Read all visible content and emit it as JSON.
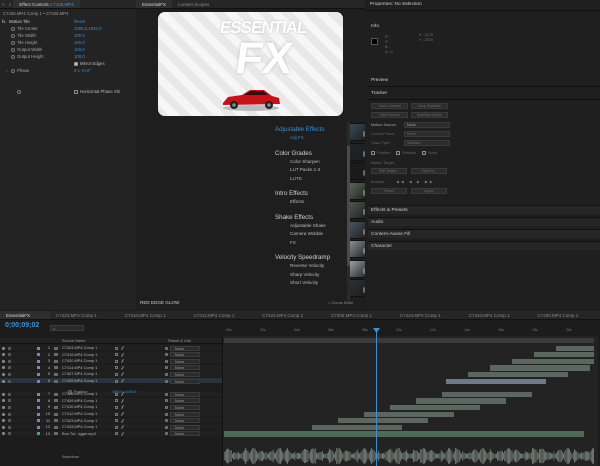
{
  "effect_controls": {
    "tab_label": "Effect Controls",
    "tab_source": "C7425.MP4",
    "breadcrumb": "C7425.MP4 Comp 1 • C7425.MP4",
    "effect_name": "Motion Tile",
    "reset_label": "Reset",
    "properties": [
      {
        "label": "Tile Center",
        "value": "1080.0,1920.0"
      },
      {
        "label": "Tile Width",
        "value": "100.0"
      },
      {
        "label": "Tile Height",
        "value": "100.0"
      },
      {
        "label": "Output Width",
        "value": "100.0"
      },
      {
        "label": "Output Height",
        "value": "100.0"
      }
    ],
    "mirror_edges_label": "Mirror Edges",
    "phase_label": "Phase",
    "phase_value": "0 x +0.0°",
    "horizontal_phase_label": "Horizontal Phase Shi"
  },
  "essential_panel": {
    "tab_active": "EssentialFX",
    "tab_other": "Lumetri Scopes",
    "logo_line1": "ESSENTIAL",
    "logo_line2": "FX",
    "footer_left": "RED EDGE GLOW",
    "footer_right": "< Gonna Mode",
    "categories": [
      {
        "title": "Adjustable Effects",
        "items": [
          "Adj FX"
        ],
        "highlight": true
      },
      {
        "title": "Color Grades",
        "items": [
          "Color Sharpen",
          "LUT Packs 1-3",
          "LUTS"
        ]
      },
      {
        "title": "Intro Effects",
        "items": [
          "Effects"
        ]
      },
      {
        "title": "Shake Effects",
        "items": [
          "Adjustable Shake",
          "Camera Wobble",
          "FX"
        ]
      },
      {
        "title": "Velocity Speedramp",
        "items": [
          "Reverse Velocity",
          "Sharp Velocity",
          "Short Velocity"
        ]
      }
    ],
    "thumb_colors": [
      "#3a4a56",
      "#2a3138",
      "#20262b",
      "#b9c0c6",
      "#1a1a1a",
      "#6e7378",
      "#5a6b5e",
      "#3f4d42",
      "#52594f",
      "#7a8c96",
      "#4a5560",
      "#2e363c",
      "#8a9196",
      "#1f9c2b",
      "#9aa3a8",
      "#7d868c",
      "#2c3236",
      "#5e666c"
    ]
  },
  "right_panel": {
    "header": "Properties: No Selection",
    "info": {
      "title": "Info",
      "x_label": "X :",
      "x_value": "1170",
      "y_label": "Y :",
      "y_value": "2070",
      "r": "R :",
      "g": "G :",
      "b": "B :",
      "a": "A : 0"
    },
    "preview_label": "Preview",
    "tracker": {
      "title": "Tracker",
      "buttons": [
        "Track Camera",
        "Warp Stabilizer",
        "Track Motion",
        "Stabilize Motion"
      ],
      "motion_source_label": "Motion Source:",
      "motion_source_value": "None",
      "current_track_label": "Current Track:",
      "current_track_value": "None",
      "track_type_label": "Track Type:",
      "track_type_value": "Stabilize",
      "position_label": "Position",
      "rotation_label": "Rotation",
      "scale_label": "Scale",
      "motion_target_label": "Motion Target:",
      "edit_target_label": "Edit Target...",
      "options_label": "Options...",
      "analyze_label": "Analyze:",
      "reset_label": "Reset",
      "apply_label": "Apply"
    },
    "sections": [
      "Effects & Presets",
      "Audio",
      "Content-Aware Fill",
      "Character"
    ]
  },
  "timeline": {
    "tabs": [
      "EssentialFX",
      "C7423.MP4 Comp 1",
      "C7410.MP4 Comp 1",
      "C7412.MP4 Comp 1",
      "C7423.MP4 Comp 1",
      "C7408.MP4 Comp 1",
      "C7424.MP4 Comp 1",
      "C7433.MP4 Comp 1",
      "C7430.MP4 Comp 1"
    ],
    "timecode": "0;00;09;02",
    "search_placeholder": "ρ",
    "col_source": "Source Name",
    "col_parent": "Parent & Link",
    "time_ticks": [
      "00s",
      "02s",
      "04s",
      "06s",
      "08s",
      "10s",
      "12s",
      "14s",
      "16s",
      "18s",
      "20s"
    ],
    "position_label": "Position",
    "position_value": "1080.0,1920.0",
    "waveform_label": "Waveform",
    "layers": [
      {
        "num": "1",
        "name": "C7424.MP4 Comp 1",
        "parent": "None",
        "color": "#8a7fb0"
      },
      {
        "num": "2",
        "name": "C7419.MP4 Comp 1",
        "parent": "None",
        "color": "#8a7fb0"
      },
      {
        "num": "3",
        "name": "C7420.MP4 Comp 1",
        "parent": "None",
        "color": "#8a7fb0"
      },
      {
        "num": "4",
        "name": "C7414.MP4 Comp 1",
        "parent": "None",
        "color": "#8a7fb0"
      },
      {
        "num": "5",
        "name": "C7407.MP4 Comp 1",
        "parent": "None",
        "color": "#8a7fb0"
      },
      {
        "num": "6",
        "name": "C7425.MP4 Comp 1",
        "parent": "None",
        "color": "#8a7fb0"
      },
      {
        "num": "7",
        "name": "C7408.MP4 Comp 1",
        "parent": "None",
        "color": "#8a7fb0"
      },
      {
        "num": "8",
        "name": "C7409.MP4 Comp 1",
        "parent": "None",
        "color": "#8a7fb0"
      },
      {
        "num": "9",
        "name": "C7410.MP4 Comp 1",
        "parent": "None",
        "color": "#8a7fb0"
      },
      {
        "num": "10",
        "name": "C7412.MP4 Comp 1",
        "parent": "None",
        "color": "#8a7fb0"
      },
      {
        "num": "11",
        "name": "C7423.MP4 Comp 1",
        "parent": "None",
        "color": "#8a7fb0"
      },
      {
        "num": "12",
        "name": "C7433.MP4 Comp 1",
        "parent": "None",
        "color": "#8a7fb0"
      },
      {
        "num": "13",
        "name": "Bon Tut...igger.mp3",
        "parent": "None",
        "color": "#5f9a72"
      }
    ]
  }
}
